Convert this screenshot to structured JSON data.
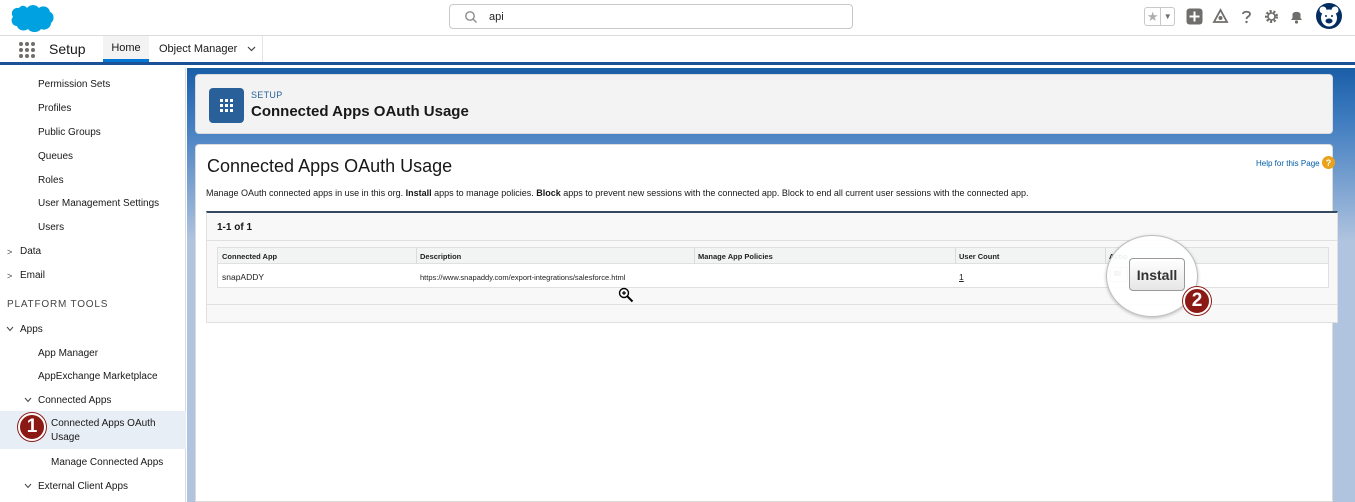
{
  "header": {
    "search": {
      "value": "api"
    },
    "icons": [
      "salesforce-cloud-logo",
      "search-icon",
      "favorites-star-icon",
      "dropdown-icon",
      "add-icon",
      "trailhead-icon",
      "help-icon",
      "setup-gear-icon",
      "bell-icon",
      "user-avatar"
    ]
  },
  "nav": {
    "app_name": "Setup",
    "tabs": [
      {
        "label": "Home",
        "active": true
      },
      {
        "label": "Object Manager",
        "has_dropdown": true
      }
    ]
  },
  "sidebar": {
    "items": [
      {
        "label": "Permission Sets"
      },
      {
        "label": "Profiles"
      },
      {
        "label": "Public Groups"
      },
      {
        "label": "Queues"
      },
      {
        "label": "Roles"
      },
      {
        "label": "User Management Settings"
      },
      {
        "label": "Users"
      },
      {
        "label": "Data",
        "collapsed": true
      },
      {
        "label": "Email",
        "collapsed": true
      },
      {
        "label": "Apps",
        "expanded": true
      },
      {
        "label": "App Manager"
      },
      {
        "label": "AppExchange Marketplace"
      },
      {
        "label": "Connected Apps",
        "expanded": true
      },
      {
        "label": "Connected Apps OAuth Usage",
        "selected": true
      },
      {
        "label": "Manage Connected Apps"
      },
      {
        "label": "External Client Apps",
        "expanded": true
      }
    ],
    "section_heading": "PLATFORM TOOLS",
    "step_badge": "1"
  },
  "page_header": {
    "eyebrow": "SETUP",
    "title": "Connected Apps OAuth Usage"
  },
  "content": {
    "title": "Connected Apps OAuth Usage",
    "help_link": "Help for this Page",
    "help_icon_glyph": "?",
    "description": {
      "part1": "Manage OAuth connected apps in use in this org. ",
      "bold1": "Install",
      "part2": " apps to manage policies. ",
      "bold2": "Block",
      "part3": " apps to prevent new sessions with the connected app. Block to end all current user sessions with the connected app."
    },
    "pagination": "1-1 of 1",
    "table": {
      "columns": [
        "Connected App",
        "Description",
        "Manage App Policies",
        "User Count",
        "Actio"
      ],
      "rows": [
        {
          "app": "snapADDY",
          "description": "https://www.snapaddy.com/export-integrations/salesforce.html",
          "policies": "",
          "user_count": "1",
          "block_label": "Bl"
        }
      ]
    },
    "install_label": "Install",
    "step_badge": "2"
  },
  "colors": {
    "brand": "#1b5297",
    "badge": "#8b1a14",
    "header_icon_bg": "#2a6099",
    "help_icon": "#e9a21a"
  }
}
